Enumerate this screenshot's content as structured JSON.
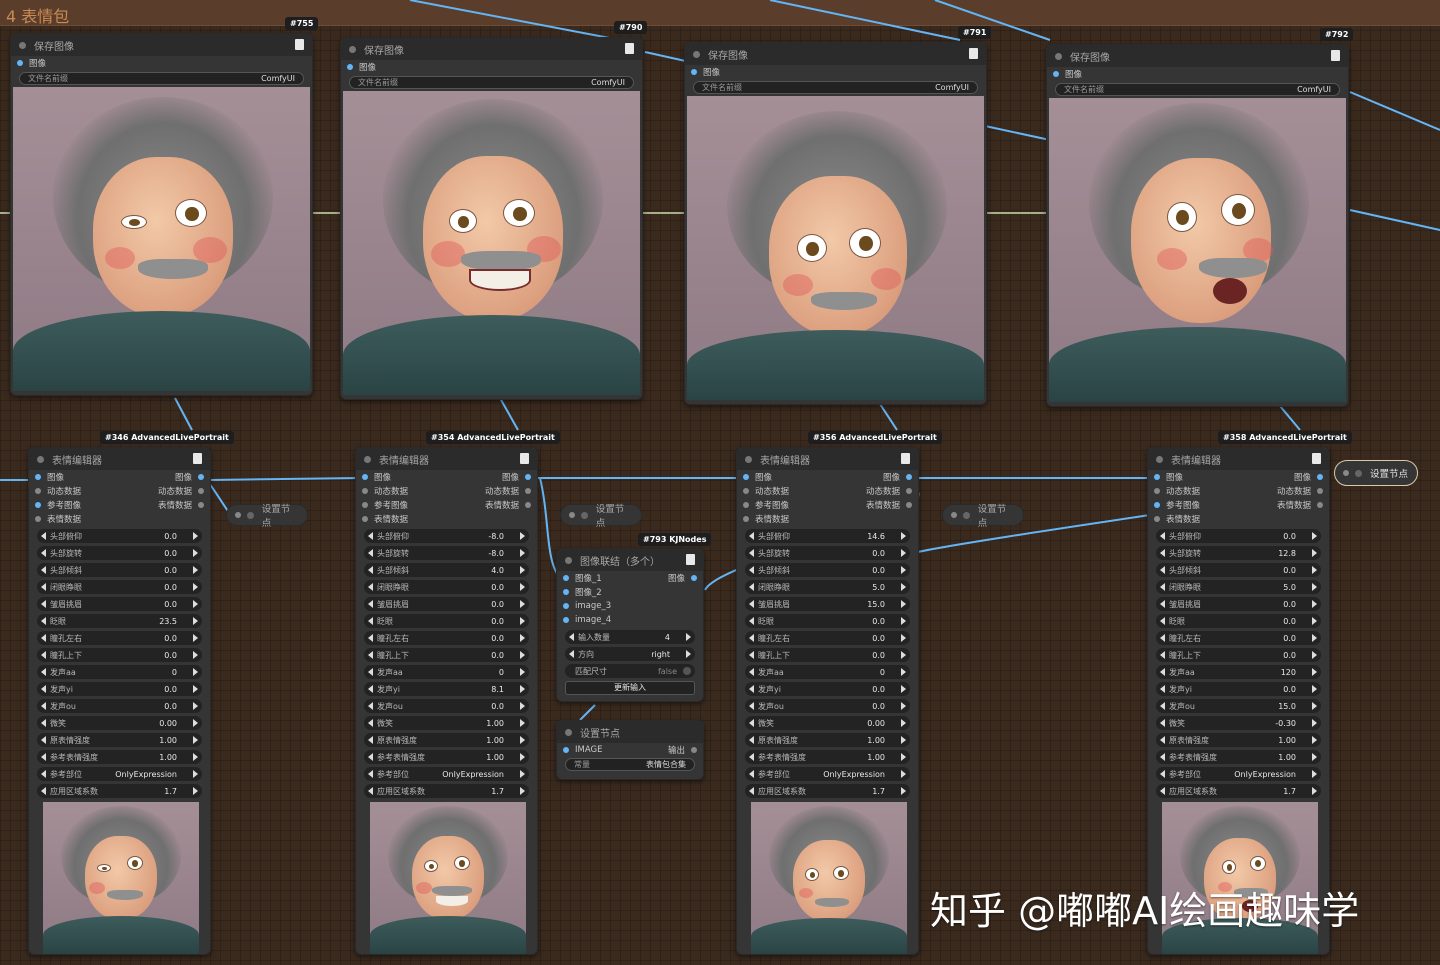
{
  "group": {
    "title": "4 表情包"
  },
  "save_nodes": [
    {
      "badge": "#755",
      "title": "保存图像",
      "port_label": "图像",
      "field_label": "文件名前缀",
      "field_value": "ComfyUI"
    },
    {
      "badge": "#790",
      "title": "保存图像",
      "port_label": "图像",
      "field_label": "文件名前缀",
      "field_value": "ComfyUI"
    },
    {
      "badge": "#791",
      "title": "保存图像",
      "port_label": "图像",
      "field_label": "文件名前缀",
      "field_value": "ComfyUI"
    },
    {
      "badge": "#792",
      "title": "保存图像",
      "port_label": "图像",
      "field_label": "文件名前缀",
      "field_value": "ComfyUI"
    }
  ],
  "editor_nodes": [
    {
      "badge": "#346 AdvancedLivePortrait",
      "title": "表情编辑器",
      "ports": [
        {
          "in": "图像",
          "out": "图像"
        },
        {
          "in": "动态数据",
          "out": "动态数据"
        },
        {
          "in": "参考图像",
          "out": "表情数据"
        },
        {
          "in": "表情数据",
          "out": ""
        }
      ],
      "widgets": [
        {
          "label": "头部俯仰",
          "value": "0.0"
        },
        {
          "label": "头部旋转",
          "value": "0.0"
        },
        {
          "label": "头部倾斜",
          "value": "0.0"
        },
        {
          "label": "闭眼睁眼",
          "value": "0.0"
        },
        {
          "label": "皱眉挑眉",
          "value": "0.0"
        },
        {
          "label": "眨眼",
          "value": "23.5"
        },
        {
          "label": "瞳孔左右",
          "value": "0.0"
        },
        {
          "label": "瞳孔上下",
          "value": "0.0"
        },
        {
          "label": "发声aa",
          "value": "0"
        },
        {
          "label": "发声yi",
          "value": "0.0"
        },
        {
          "label": "发声ou",
          "value": "0.0"
        },
        {
          "label": "微笑",
          "value": "0.00"
        },
        {
          "label": "原表情强度",
          "value": "1.00"
        },
        {
          "label": "参考表情强度",
          "value": "1.00"
        },
        {
          "label": "参考部位",
          "value": "OnlyExpression"
        },
        {
          "label": "应用区域系数",
          "value": "1.7"
        }
      ]
    },
    {
      "badge": "#354 AdvancedLivePortrait",
      "title": "表情编辑器",
      "ports": [
        {
          "in": "图像",
          "out": "图像"
        },
        {
          "in": "动态数据",
          "out": "动态数据"
        },
        {
          "in": "参考图像",
          "out": "表情数据"
        },
        {
          "in": "表情数据",
          "out": ""
        }
      ],
      "widgets": [
        {
          "label": "头部俯仰",
          "value": "-8.0"
        },
        {
          "label": "头部旋转",
          "value": "-8.0"
        },
        {
          "label": "头部倾斜",
          "value": "4.0"
        },
        {
          "label": "闭眼睁眼",
          "value": "0.0"
        },
        {
          "label": "皱眉挑眉",
          "value": "0.0"
        },
        {
          "label": "眨眼",
          "value": "0.0"
        },
        {
          "label": "瞳孔左右",
          "value": "0.0"
        },
        {
          "label": "瞳孔上下",
          "value": "0.0"
        },
        {
          "label": "发声aa",
          "value": "0"
        },
        {
          "label": "发声yi",
          "value": "8.1"
        },
        {
          "label": "发声ou",
          "value": "0.0"
        },
        {
          "label": "微笑",
          "value": "1.00"
        },
        {
          "label": "原表情强度",
          "value": "1.00"
        },
        {
          "label": "参考表情强度",
          "value": "1.00"
        },
        {
          "label": "参考部位",
          "value": "OnlyExpression"
        },
        {
          "label": "应用区域系数",
          "value": "1.7"
        }
      ]
    },
    {
      "badge": "#356 AdvancedLivePortrait",
      "title": "表情编辑器",
      "ports": [
        {
          "in": "图像",
          "out": "图像"
        },
        {
          "in": "动态数据",
          "out": "动态数据"
        },
        {
          "in": "参考图像",
          "out": "表情数据"
        },
        {
          "in": "表情数据",
          "out": ""
        }
      ],
      "widgets": [
        {
          "label": "头部俯仰",
          "value": "14.6"
        },
        {
          "label": "头部旋转",
          "value": "0.0"
        },
        {
          "label": "头部倾斜",
          "value": "0.0"
        },
        {
          "label": "闭眼睁眼",
          "value": "5.0"
        },
        {
          "label": "皱眉挑眉",
          "value": "15.0"
        },
        {
          "label": "眨眼",
          "value": "0.0"
        },
        {
          "label": "瞳孔左右",
          "value": "0.0"
        },
        {
          "label": "瞳孔上下",
          "value": "0.0"
        },
        {
          "label": "发声aa",
          "value": "0"
        },
        {
          "label": "发声yi",
          "value": "0.0"
        },
        {
          "label": "发声ou",
          "value": "0.0"
        },
        {
          "label": "微笑",
          "value": "0.00"
        },
        {
          "label": "原表情强度",
          "value": "1.00"
        },
        {
          "label": "参考表情强度",
          "value": "1.00"
        },
        {
          "label": "参考部位",
          "value": "OnlyExpression"
        },
        {
          "label": "应用区域系数",
          "value": "1.7"
        }
      ]
    },
    {
      "badge": "#358 AdvancedLivePortrait",
      "title": "表情编辑器",
      "ports": [
        {
          "in": "图像",
          "out": "图像"
        },
        {
          "in": "动态数据",
          "out": "动态数据"
        },
        {
          "in": "参考图像",
          "out": "表情数据"
        },
        {
          "in": "表情数据",
          "out": ""
        }
      ],
      "widgets": [
        {
          "label": "头部俯仰",
          "value": "0.0"
        },
        {
          "label": "头部旋转",
          "value": "12.8"
        },
        {
          "label": "头部倾斜",
          "value": "0.0"
        },
        {
          "label": "闭眼睁眼",
          "value": "5.0"
        },
        {
          "label": "皱眉挑眉",
          "value": "0.0"
        },
        {
          "label": "眨眼",
          "value": "0.0"
        },
        {
          "label": "瞳孔左右",
          "value": "0.0"
        },
        {
          "label": "瞳孔上下",
          "value": "0.0"
        },
        {
          "label": "发声aa",
          "value": "120"
        },
        {
          "label": "发声yi",
          "value": "0.0"
        },
        {
          "label": "发声ou",
          "value": "15.0"
        },
        {
          "label": "微笑",
          "value": "-0.30"
        },
        {
          "label": "原表情强度",
          "value": "1.00"
        },
        {
          "label": "参考表情强度",
          "value": "1.00"
        },
        {
          "label": "参考部位",
          "value": "OnlyExpression"
        },
        {
          "label": "应用区域系数",
          "value": "1.7"
        }
      ]
    }
  ],
  "set_nodes": {
    "label": "设置节点"
  },
  "concat_node": {
    "badge": "#793 KJNodes",
    "title": "图像联结（多个）",
    "ports": [
      "图像_1",
      "图像_2",
      "image_3",
      "image_4"
    ],
    "out_label": "图像",
    "widgets": [
      {
        "label": "输入数量",
        "value": "4"
      },
      {
        "label": "方向",
        "value": "right"
      },
      {
        "label": "匹配尺寸",
        "value": "false"
      }
    ],
    "button": "更新输入"
  },
  "const_node": {
    "title": "设置节点",
    "in_label": "IMAGE",
    "out_label": "输出",
    "field_label": "常量",
    "field_value": "表情包合集"
  },
  "watermark": "知乎 @嘟嘟AI绘画趣味学",
  "colors": {
    "wire_blue": "#64b5f6",
    "wire_green": "#a5b08a",
    "group_title": "#c98a54"
  }
}
